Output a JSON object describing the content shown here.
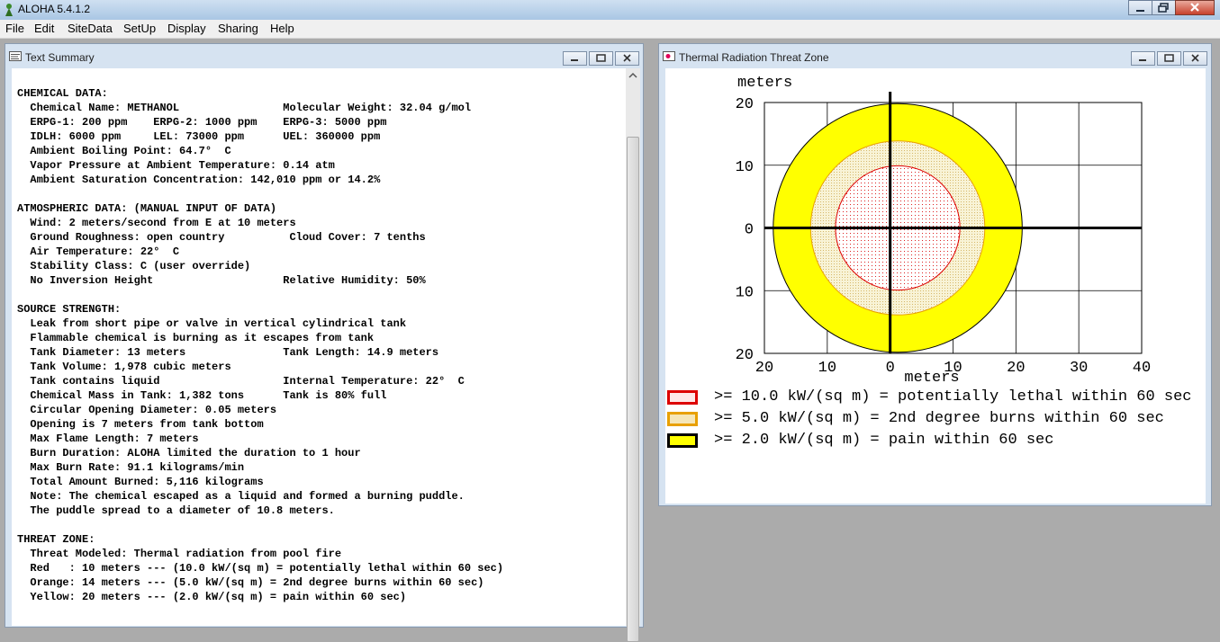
{
  "app": {
    "title": "ALOHA 5.4.1.2"
  },
  "menu": [
    "File",
    "Edit",
    "SiteData",
    "SetUp",
    "Display",
    "Sharing",
    "Help"
  ],
  "summary_window": {
    "title": "Text Summary",
    "lines": [
      "CHEMICAL DATA:",
      "  Chemical Name: METHANOL                Molecular Weight: 32.04 g/mol",
      "  ERPG-1: 200 ppm    ERPG-2: 1000 ppm    ERPG-3: 5000 ppm",
      "  IDLH: 6000 ppm     LEL: 73000 ppm      UEL: 360000 ppm",
      "  Ambient Boiling Point: 64.7°  C",
      "  Vapor Pressure at Ambient Temperature: 0.14 atm",
      "  Ambient Saturation Concentration: 142,010 ppm or 14.2%",
      "",
      "ATMOSPHERIC DATA: (MANUAL INPUT OF DATA)",
      "  Wind: 2 meters/second from E at 10 meters",
      "  Ground Roughness: open country          Cloud Cover: 7 tenths",
      "  Air Temperature: 22°  C",
      "  Stability Class: C (user override)",
      "  No Inversion Height                    Relative Humidity: 50%",
      "",
      "SOURCE STRENGTH:",
      "  Leak from short pipe or valve in vertical cylindrical tank",
      "  Flammable chemical is burning as it escapes from tank",
      "  Tank Diameter: 13 meters               Tank Length: 14.9 meters",
      "  Tank Volume: 1,978 cubic meters",
      "  Tank contains liquid                   Internal Temperature: 22°  C",
      "  Chemical Mass in Tank: 1,382 tons      Tank is 80% full",
      "  Circular Opening Diameter: 0.05 meters",
      "  Opening is 7 meters from tank bottom",
      "  Max Flame Length: 7 meters",
      "  Burn Duration: ALOHA limited the duration to 1 hour",
      "  Max Burn Rate: 91.1 kilograms/min",
      "  Total Amount Burned: 5,116 kilograms",
      "  Note: The chemical escaped as a liquid and formed a burning puddle.",
      "  The puddle spread to a diameter of 10.8 meters.",
      "",
      "THREAT ZONE:",
      "  Threat Modeled: Thermal radiation from pool fire",
      "  Red   : 10 meters --- (10.0 kW/(sq m) = potentially lethal within 60 sec)",
      "  Orange: 14 meters --- (5.0 kW/(sq m) = 2nd degree burns within 60 sec)",
      "  Yellow: 20 meters --- (2.0 kW/(sq m) = pain within 60 sec)"
    ]
  },
  "threat_window": {
    "title": "Thermal Radiation Threat Zone",
    "y_axis_label": "meters",
    "x_axis_label": "meters",
    "x_ticks": [
      {
        "value": -20,
        "label": "20"
      },
      {
        "value": -10,
        "label": "10"
      },
      {
        "value": 0,
        "label": "0"
      },
      {
        "value": 10,
        "label": "10"
      },
      {
        "value": 20,
        "label": "20"
      },
      {
        "value": 30,
        "label": "30"
      },
      {
        "value": 40,
        "label": "40"
      }
    ],
    "y_ticks": [
      {
        "value": 20,
        "label": "20"
      },
      {
        "value": 10,
        "label": "10"
      },
      {
        "value": 0,
        "label": "0"
      },
      {
        "value": -10,
        "label": "10"
      },
      {
        "value": -20,
        "label": "20"
      }
    ],
    "x_range": [
      -20,
      40
    ],
    "y_range": [
      -20,
      20
    ],
    "zones": [
      {
        "level": "yellow",
        "radius_m": 20,
        "fill": "#ffff00",
        "stroke": "#000000"
      },
      {
        "level": "orange",
        "radius_m": 14,
        "fill": "#f5f0c8",
        "stroke": "#e8a000"
      },
      {
        "level": "red",
        "radius_m": 10,
        "fill": "#ffffff",
        "stroke": "#dd0000"
      }
    ],
    "source_center": [
      0,
      0
    ],
    "circle_center_offset_m": [
      1.2,
      0
    ],
    "legend": [
      {
        "color": "#dd0000",
        "fill": "#ffe8e8",
        "text": ">= 10.0 kW/(sq m) = potentially lethal within 60 sec"
      },
      {
        "color": "#e8a000",
        "fill": "#f5e6b8",
        "text": ">= 5.0 kW/(sq m) = 2nd degree burns within 60 sec"
      },
      {
        "color": "#000000",
        "fill": "#ffff00",
        "text": ">= 2.0 kW/(sq m) = pain within 60 sec"
      }
    ]
  }
}
